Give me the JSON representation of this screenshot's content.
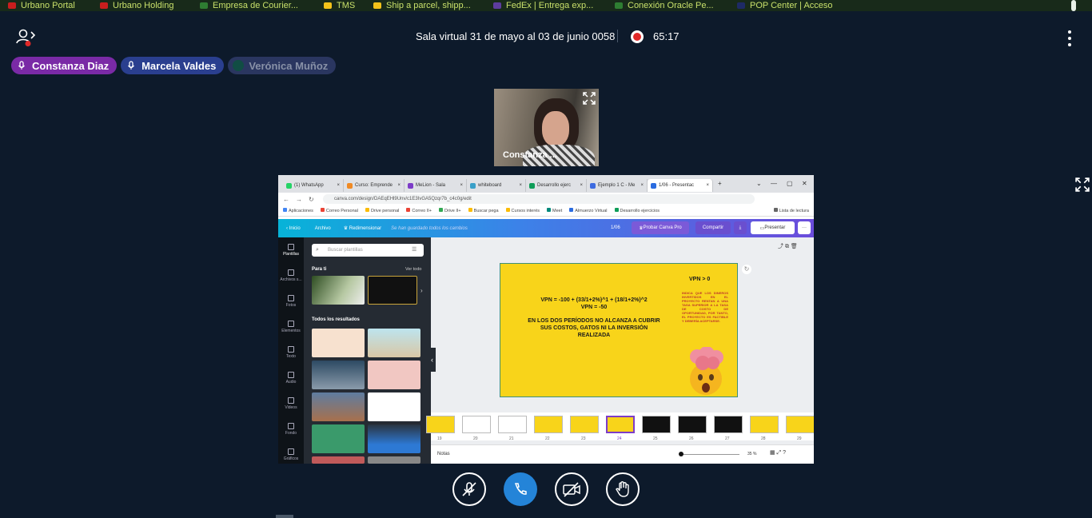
{
  "bookmarks_top": [
    {
      "label": "Urbano Portal",
      "color": "#c81e1e"
    },
    {
      "label": "Urbano Holding",
      "color": "#c81e1e"
    },
    {
      "label": "Empresa de Courier...",
      "color": "#2e7d32"
    },
    {
      "label": "TMS",
      "color": "#f3c21a"
    },
    {
      "label": "Ship a parcel, shipp...",
      "color": "#f3c21a"
    },
    {
      "label": "FedEx | Entrega exp...",
      "color": "#5d3c9e"
    },
    {
      "label": "Conexión Oracle Pe...",
      "color": "#2e7d32"
    },
    {
      "label": "POP Center | Acceso",
      "color": "#1e2a66"
    }
  ],
  "header": {
    "title": "Sala virtual 31 de mayo al 03 de junio 0058",
    "timer": "65:17"
  },
  "participants": [
    {
      "name": "Constanza Diaz"
    },
    {
      "name": "Marcela Valdes"
    },
    {
      "name": "Verónica Muñoz"
    }
  ],
  "video": {
    "name": "Constanza ..."
  },
  "browser": {
    "tabs": [
      {
        "label": "(1) WhatsApp",
        "color": "#25d366"
      },
      {
        "label": "Curso: Emprende",
        "color": "#f08a24"
      },
      {
        "label": "MeLion - Sala",
        "color": "#7d3cc8"
      },
      {
        "label": "whiteboard",
        "color": "#3aa0c8"
      },
      {
        "label": "Desarrollo ejerc",
        "color": "#0f9d58"
      },
      {
        "label": "Ejemplo 1 C - Me",
        "color": "#3d6be0"
      },
      {
        "label": "1/06 - Presentac",
        "color": "#2b6ce0"
      }
    ],
    "url": "canva.com/design/DAEqEHl9Unv/c1E3IvGA5Qzqr7b_c4c0g/edit",
    "bookmarks": [
      "Aplicaciones",
      "Correo Personal",
      "Drive personal",
      "Correo II+",
      "Drive II+",
      "Buscar pega",
      "Cursos interés",
      "Meet",
      "Almuerzo Virtual",
      "Desarrollo ejercicios",
      "Lista de lectura"
    ]
  },
  "canva": {
    "nav": {
      "inicio": "Inicio",
      "archivo": "Archivo",
      "redimensionar": "Redimensionar",
      "saved": "Se han guardado todos los cambios"
    },
    "page_count": "1/06",
    "probar": "Probar Canva Pro",
    "compartir": "Compartir",
    "presentar": "Presentar",
    "rail": [
      "Plantillas",
      "Archivos s...",
      "Fotos",
      "Elementos",
      "Texto",
      "Audio",
      "Videos",
      "Fondo",
      "Gráficos"
    ],
    "search_placeholder": "Buscar plantillas",
    "para_ti": "Para ti",
    "ver_todo": "Ver todo",
    "todos": "Todos los resultados",
    "slide": {
      "vpn_title": "VPN > 0",
      "formula": "VPN = -100 + (33/1+2%)^1 + (18/1+2%)^2",
      "result": "VPN = -50",
      "text1": "EN LOS DOS PERÍODOS NO ALCANZA A CUBRIR",
      "text2": "SUS COSTOS, GATOS NI LA INVERSIÓN",
      "text3": "REALIZADA",
      "red_note": "INDICA QUE LOS DINEROS INVERTIDOS EN EL PROYECTO RENTAN A UNA TASA SUPERIOR A LA TASA DE COSTO DE OPORTUNIDAD, POR TANTO, EL PROYECTO ES FACTIBLE Y DEBERÍA ACEPTARSE."
    },
    "strip_numbers": [
      "19",
      "20",
      "21",
      "22",
      "23",
      "24",
      "25",
      "26",
      "27",
      "28",
      "29"
    ],
    "notas": "Notas",
    "zoom": "35 %"
  }
}
